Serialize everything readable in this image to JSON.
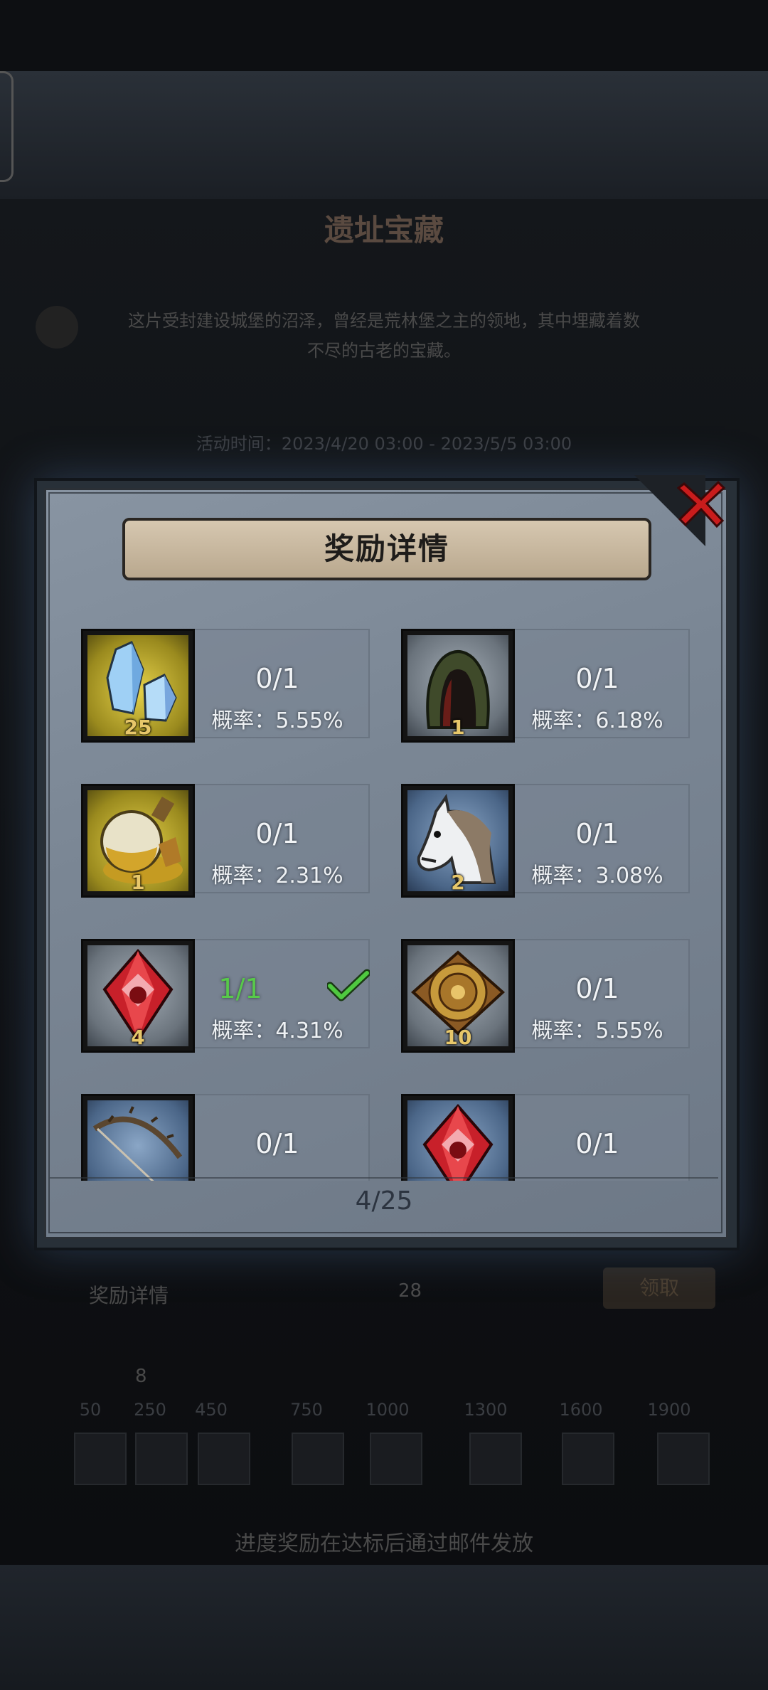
{
  "background": {
    "title": "遗址宝藏",
    "description_line1": "这片受封建设城堡的沼泽，曾经是荒林堡之主的领地，其中埋藏着数",
    "description_line2": "不尽的古老的宝藏。",
    "activity_time": "活动时间：2023/4/20 03:00 - 2023/5/5 03:00",
    "reward_label": "奖励详情",
    "reward_count": "28",
    "claim_label": "领取",
    "points": "8",
    "milestones": [
      "50",
      "250",
      "450",
      "750",
      "1000",
      "1300",
      "1600",
      "1900"
    ],
    "footer": "进度奖励在达标后通过邮件发放"
  },
  "modal": {
    "title": "奖励详情",
    "close_icon": "close-x-icon",
    "rate_prefix": "概率：",
    "items": [
      {
        "icon": "crystal-icon",
        "qty": "25",
        "progress": "0/1",
        "rate": "概率：5.55%",
        "done": false,
        "rarity": "gold"
      },
      {
        "icon": "hooded-cloak-icon",
        "qty": "1",
        "progress": "0/1",
        "rate": "概率：6.18%",
        "done": false,
        "rarity": "gray"
      },
      {
        "icon": "gold-orb-icon",
        "qty": "1",
        "progress": "0/1",
        "rate": "概率：2.31%",
        "done": false,
        "rarity": "gold"
      },
      {
        "icon": "white-horse-icon",
        "qty": "2",
        "progress": "0/1",
        "rate": "概率：3.08%",
        "done": false,
        "rarity": "blue"
      },
      {
        "icon": "red-gem-icon",
        "qty": "4",
        "progress": "1/1",
        "rate": "概率：4.31%",
        "done": true,
        "rarity": "gray"
      },
      {
        "icon": "ornate-tile-icon",
        "qty": "10",
        "progress": "0/1",
        "rate": "概率：5.55%",
        "done": false,
        "rarity": "gray"
      },
      {
        "icon": "thorn-bow-icon",
        "qty": "",
        "progress": "0/1",
        "rate": "",
        "done": false,
        "rarity": "blue"
      },
      {
        "icon": "red-gem-icon",
        "qty": "",
        "progress": "0/1",
        "rate": "",
        "done": false,
        "rarity": "blue"
      }
    ],
    "page": "4/25"
  }
}
